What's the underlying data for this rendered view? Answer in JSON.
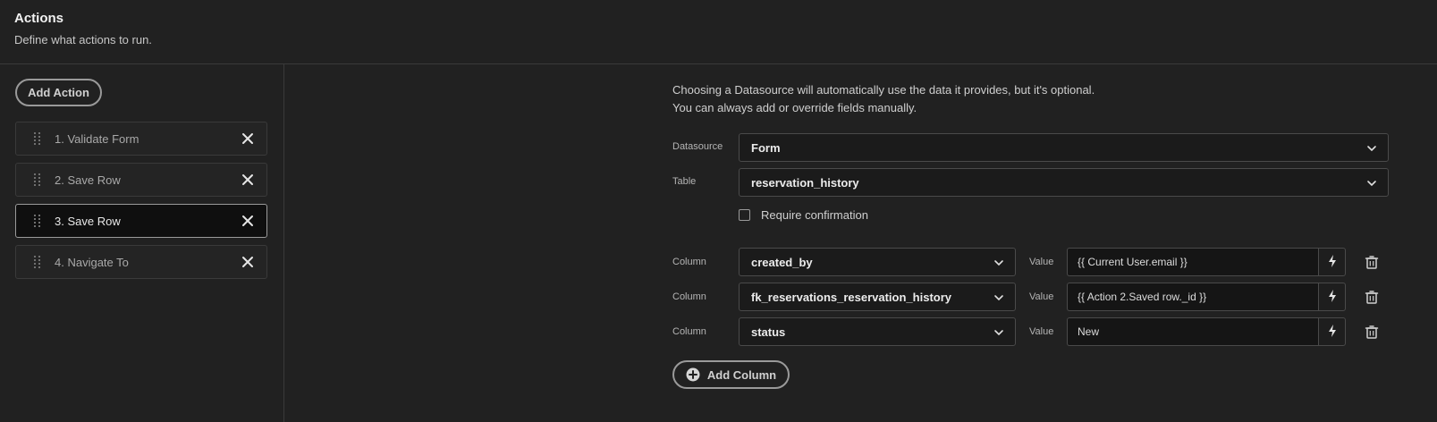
{
  "header": {
    "title": "Actions",
    "subtitle": "Define what actions to run."
  },
  "sidebar": {
    "add_action_label": "Add Action",
    "items": [
      {
        "label": "1. Validate Form",
        "selected": false
      },
      {
        "label": "2. Save Row",
        "selected": false
      },
      {
        "label": "3. Save Row",
        "selected": true
      },
      {
        "label": "4. Navigate To",
        "selected": false
      }
    ]
  },
  "main": {
    "info_line1": "Choosing a Datasource will automatically use the data it provides, but it's optional.",
    "info_line2": "You can always add or override fields manually.",
    "datasource_label": "Datasource",
    "datasource_value": "Form",
    "table_label": "Table",
    "table_value": "reservation_history",
    "require_confirmation_label": "Require confirmation",
    "require_confirmation_checked": false,
    "columns": [
      {
        "column_label": "Column",
        "column_value": "created_by",
        "value_label": "Value",
        "value": "{{ Current User.email }}"
      },
      {
        "column_label": "Column",
        "column_value": "fk_reservations_reservation_history",
        "value_label": "Value",
        "value": "{{ Action 2.Saved row._id }}"
      },
      {
        "column_label": "Column",
        "column_value": "status",
        "value_label": "Value",
        "value": "New"
      }
    ],
    "add_column_label": "Add Column"
  },
  "icons": {
    "drag": "drag-handle-icon",
    "close": "close-icon",
    "chevron": "chevron-down-icon",
    "bolt": "lightning-icon",
    "trash": "trash-icon",
    "plus": "plus-circle-icon"
  }
}
